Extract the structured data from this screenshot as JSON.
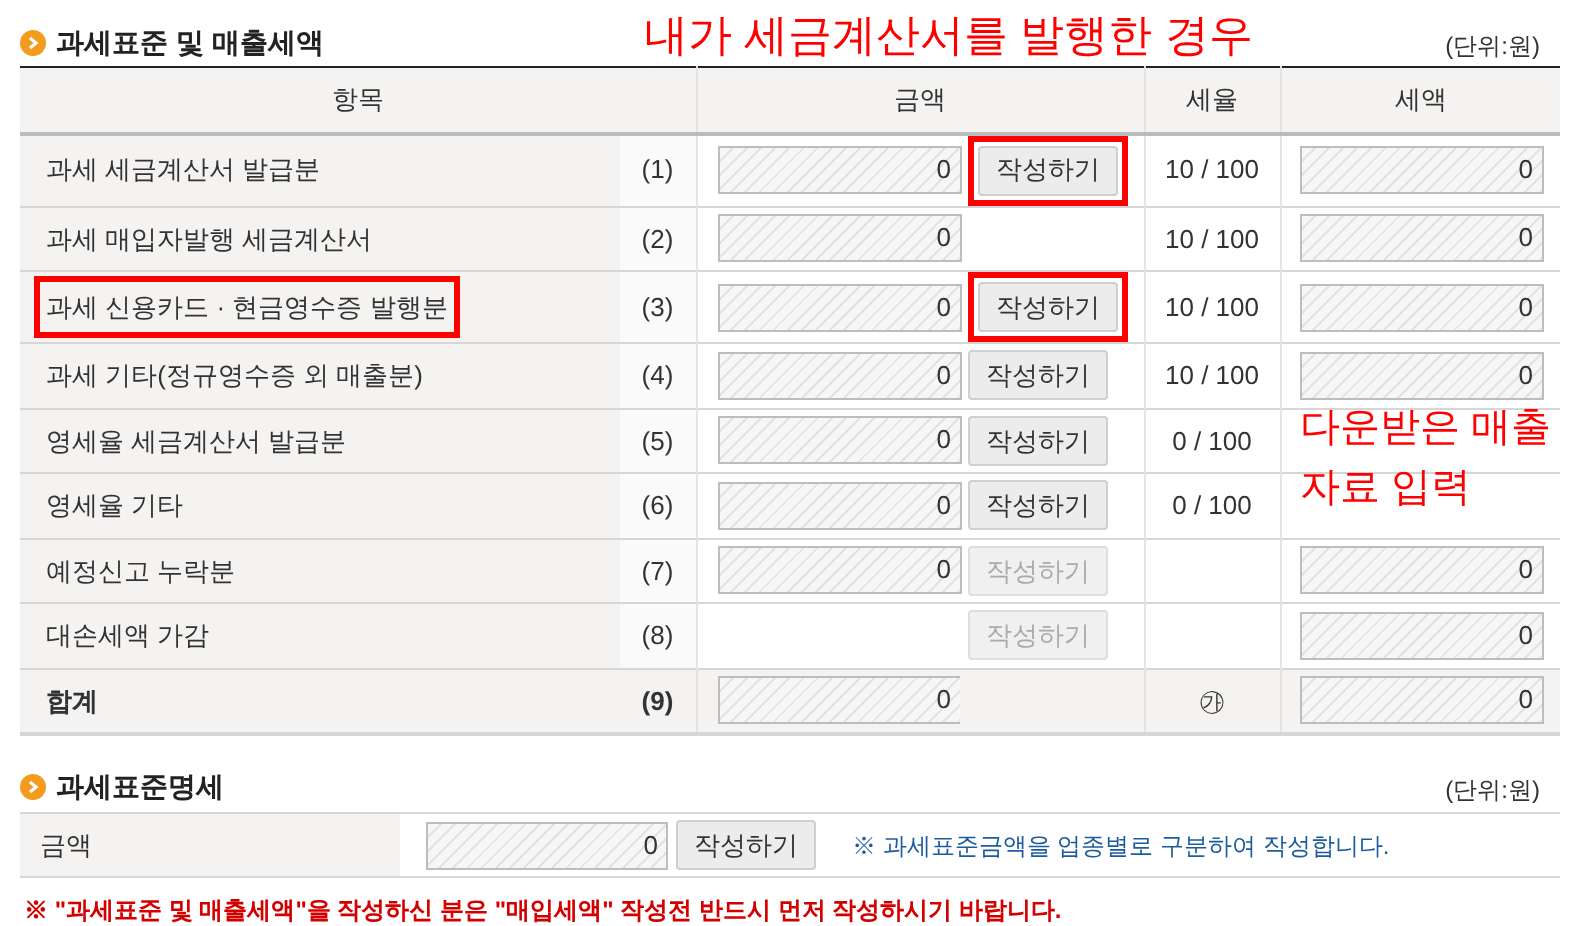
{
  "section1": {
    "title": "과세표준 및 매출세액",
    "unit": "(단위:원)",
    "columns": [
      "항목",
      "금액",
      "세율",
      "세액"
    ],
    "rows": [
      {
        "label": "과세 세금계산서 발급분",
        "num": "(1)",
        "amount": "0",
        "button": {
          "label": "작성하기",
          "disabled": false,
          "highlighted": true
        },
        "rate": "10 / 100",
        "tax": "0",
        "highlighted": false,
        "total": false
      },
      {
        "label": "과세 매입자발행 세금계산서",
        "num": "(2)",
        "amount": "0",
        "rate": "10 / 100",
        "tax": "0",
        "highlighted": false,
        "total": false
      },
      {
        "label": "과세 신용카드 · 현금영수증 발행분",
        "num": "(3)",
        "amount": "0",
        "button": {
          "label": "작성하기",
          "disabled": false,
          "highlighted": true
        },
        "rate": "10 / 100",
        "tax": "0",
        "highlighted": true,
        "total": false
      },
      {
        "label": "과세 기타(정규영수증 외 매출분)",
        "num": "(4)",
        "amount": "0",
        "button": {
          "label": "작성하기",
          "disabled": false,
          "highlighted": false
        },
        "rate": "10 / 100",
        "tax": "0",
        "highlighted": false,
        "total": false
      },
      {
        "label": "영세율 세금계산서 발급분",
        "num": "(5)",
        "amount": "0",
        "button": {
          "label": "작성하기",
          "disabled": false,
          "highlighted": false
        },
        "rate": "0 / 100",
        "highlighted": false,
        "total": false
      },
      {
        "label": "영세율 기타",
        "num": "(6)",
        "amount": "0",
        "button": {
          "label": "작성하기",
          "disabled": false,
          "highlighted": false
        },
        "rate": "0 / 100",
        "highlighted": false,
        "total": false
      },
      {
        "label": "예정신고 누락분",
        "num": "(7)",
        "amount": "0",
        "button": {
          "label": "작성하기",
          "disabled": true,
          "highlighted": false
        },
        "tax": "0",
        "highlighted": false,
        "total": false
      },
      {
        "label": "대손세액 가감",
        "num": "(8)",
        "button": {
          "label": "작성하기",
          "disabled": true,
          "highlighted": false
        },
        "tax": "0",
        "highlighted": false,
        "total": false
      },
      {
        "label": "합계",
        "num": "(9)",
        "amount": "0",
        "rate": "㉮",
        "tax": "0",
        "highlighted": false,
        "total": true
      }
    ]
  },
  "annotations": [
    {
      "text": "내가 세금계산서를 발행한 경우"
    },
    {
      "text": "다운받은 매출 자료 입력"
    }
  ],
  "section2": {
    "title": "과세표준명세",
    "unit": "(단위:원)",
    "label": "금액",
    "amount": "0",
    "button": "작성하기",
    "note": "※ 과세표준금액을 업종별로 구분하여 작성합니다."
  },
  "warning": "※ \"과세표준 및 매출세액\"을 작성하신 분은 \"매입세액\" 작성전 반드시 먼저 작성하시기 바랍니다."
}
